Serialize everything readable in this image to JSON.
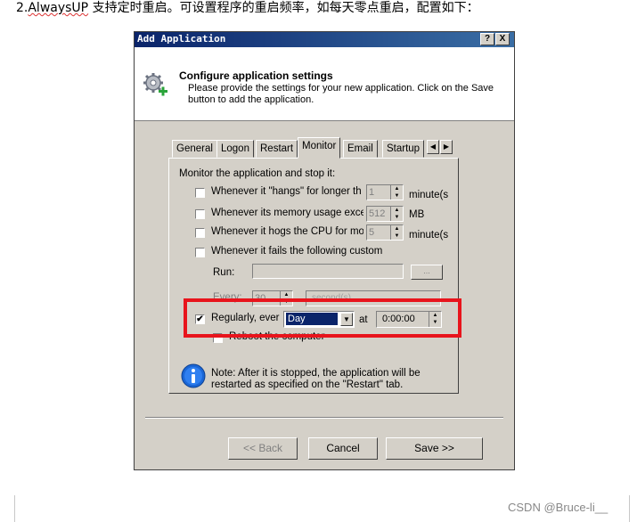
{
  "doc": {
    "caption_prefix": "2.",
    "caption_word": "AlwaysUP",
    "caption_rest": " 支持定时重启。可设置程序的重启频率，如每天零点重启，配置如下："
  },
  "dialog": {
    "title": "Add Application",
    "help_btn": "?",
    "close_btn": "X",
    "header_title": "Configure application settings",
    "header_desc": "Please provide the settings for your new application. Click on the Save button to add the application."
  },
  "tabs": [
    "General",
    "Logon",
    "Restart",
    "Monitor",
    "Email",
    "Startup"
  ],
  "panel": {
    "heading": "Monitor the application and stop it:",
    "hangs_label": "Whenever it \"hangs\" for longer th",
    "hangs_value": "1",
    "hangs_unit": "minute(s",
    "memory_label": "Whenever its memory usage exce",
    "memory_value": "512",
    "memory_unit": "MB",
    "cpu_label": "Whenever it hogs the CPU for mor",
    "cpu_value": "5",
    "cpu_unit": "minute(s",
    "custom_label": "Whenever it fails the following custom",
    "run_label": "Run:",
    "browse_label": "...",
    "every_label": "Every:",
    "every_value": "30",
    "every_unit": "second(s)",
    "regular_label": "Regularly, ever",
    "regular_checked": "✔",
    "regular_period": "Day",
    "at_label": "at",
    "time_value": "0:00:00",
    "reboot_label": "Reboot the computer",
    "note": "Note: After it is stopped, the application will be restarted as specified on the \"Restart\" tab."
  },
  "buttons": {
    "back": "<< Back",
    "cancel": "Cancel",
    "save": "Save >>"
  },
  "watermark": "CSDN @Bruce-li__",
  "colors": {
    "highlight": "#e8141c",
    "titlebar": "#0a246a",
    "selection": "#0a246a"
  }
}
